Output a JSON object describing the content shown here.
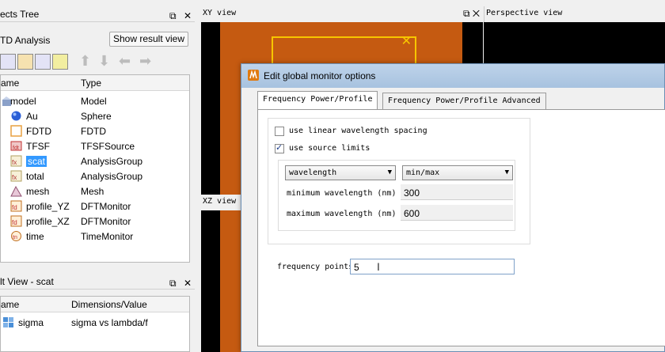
{
  "objects_panel": {
    "title": "ects Tree",
    "analysis_label": "TD Analysis",
    "show_result_button": "Show result view",
    "columns": [
      "ame",
      "Type"
    ],
    "rows": [
      {
        "name": "model",
        "type": "Model",
        "icon": "model-icon"
      },
      {
        "name": "Au",
        "type": "Sphere",
        "icon": "sphere-icon"
      },
      {
        "name": "FDTD",
        "type": "FDTD",
        "icon": "fdtd-icon"
      },
      {
        "name": "TFSF",
        "type": "TFSFSource",
        "icon": "tfsf-icon"
      },
      {
        "name": "scat",
        "type": "AnalysisGroup",
        "icon": "analysis-group-icon"
      },
      {
        "name": "total",
        "type": "AnalysisGroup",
        "icon": "analysis-group-icon"
      },
      {
        "name": "mesh",
        "type": "Mesh",
        "icon": "mesh-icon"
      },
      {
        "name": "profile_YZ",
        "type": "DFTMonitor",
        "icon": "dft-monitor-icon"
      },
      {
        "name": "profile_XZ",
        "type": "DFTMonitor",
        "icon": "dft-monitor-icon"
      },
      {
        "name": "time",
        "type": "TimeMonitor",
        "icon": "time-monitor-icon"
      }
    ]
  },
  "result_panel": {
    "title": "lt View - scat",
    "columns": [
      "ame",
      "Dimensions/Value"
    ],
    "rows": [
      {
        "name": "sigma",
        "value": "sigma vs lambda/f"
      }
    ]
  },
  "views": {
    "xy": "XY view",
    "perspective": "Perspective view",
    "xz": "XZ view"
  },
  "dialog": {
    "title": "Edit global monitor options",
    "tabs": [
      "Frequency Power/Profile",
      "Frequency Power/Profile Advanced"
    ],
    "linear_spacing_label": "use linear wavelength spacing",
    "linear_spacing_checked": false,
    "source_limits_label": "use source limits",
    "source_limits_checked": true,
    "range_type": "wavelength",
    "range_mode": "min/max",
    "min_label": "minimum wavelength (nm)",
    "min_value": "300",
    "max_label": "maximum wavelength (nm)",
    "max_value": "600",
    "freq_points_label": "frequency points",
    "freq_points_value": "5"
  },
  "colors": {
    "selection": "#3399ff",
    "sim_region": "#c55a11",
    "structure_outline": "#f7c600"
  }
}
